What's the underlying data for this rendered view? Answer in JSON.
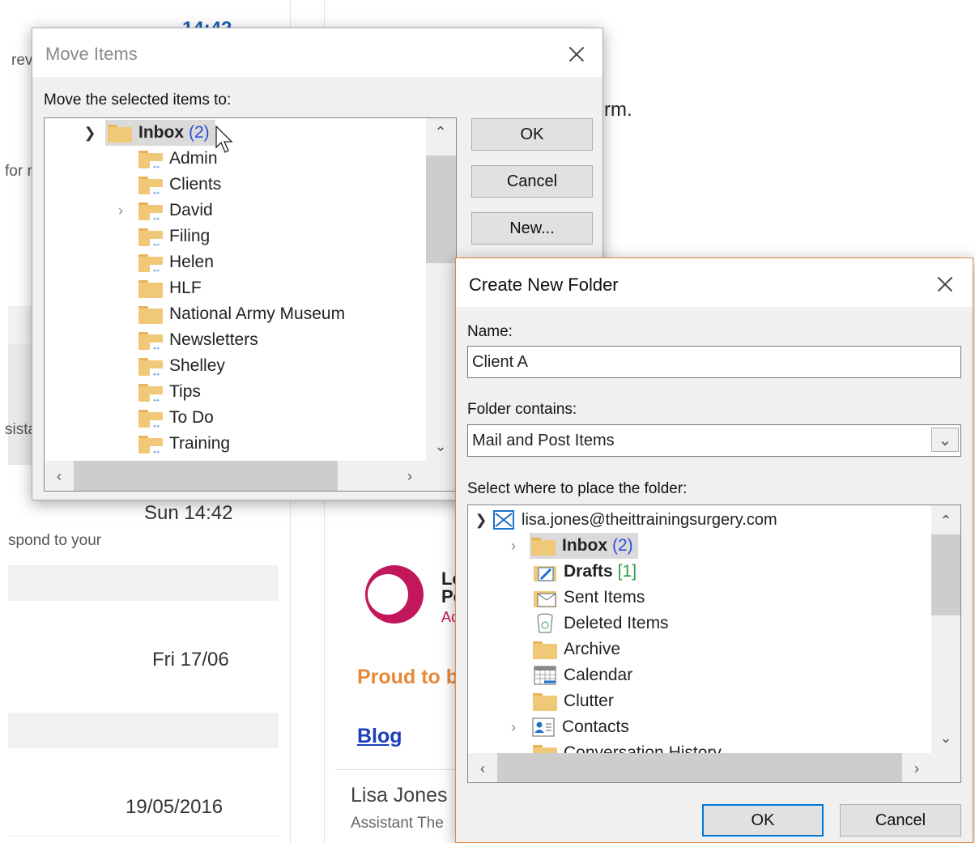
{
  "background": {
    "list_fragments": [
      "rev",
      "for r",
      "sista",
      "spond to your"
    ],
    "list_dates": [
      "14:42",
      "Sun 14:42",
      "Fri 17/06",
      "19/05/2016"
    ],
    "reading_fragments": [
      "rm.",
      "Le",
      "Pe",
      "Ac",
      "Proud to b",
      "Blog ",
      "Lisa Jones",
      "Assistant  The"
    ]
  },
  "move_dialog": {
    "title": "Move Items",
    "prompt": "Move the selected items to:",
    "folders": [
      {
        "label": "Inbox",
        "count": "(2)",
        "bold": true,
        "chevron": "v"
      },
      {
        "label": "Admin"
      },
      {
        "label": "Clients"
      },
      {
        "label": "David",
        "chevron": ">"
      },
      {
        "label": "Filing"
      },
      {
        "label": "Helen"
      },
      {
        "label": "HLF"
      },
      {
        "label": "National Army Museum"
      },
      {
        "label": "Newsletters"
      },
      {
        "label": "Shelley"
      },
      {
        "label": "Tips"
      },
      {
        "label": "To Do"
      },
      {
        "label": "Training"
      }
    ],
    "ok_label": "OK",
    "cancel_label": "Cancel",
    "new_label": "New..."
  },
  "create_dialog": {
    "title": "Create New Folder",
    "name_label": "Name:",
    "name_value": "Client A",
    "contains_label": "Folder contains:",
    "contains_value": "Mail and Post Items",
    "place_label": "Select where to place the folder:",
    "account": "lisa.jones@theittrainingsurgery.com",
    "folders": [
      {
        "label": "Inbox",
        "count": "(2)",
        "bold": true,
        "chevron": ">"
      },
      {
        "label": "Drafts",
        "count": "[1]",
        "bold": true
      },
      {
        "label": "Sent Items"
      },
      {
        "label": "Deleted Items"
      },
      {
        "label": "Archive"
      },
      {
        "label": "Calendar"
      },
      {
        "label": "Clutter"
      },
      {
        "label": "Contacts",
        "chevron": ">"
      },
      {
        "label": "Conversation History"
      }
    ],
    "ok_label": "OK",
    "cancel_label": "Cancel"
  },
  "colors": {
    "accent": "#0078d7",
    "dialog_border_active": "#e6883c",
    "count_blue": "#2a4fd6",
    "count_green": "#2e9e3e",
    "link": "#1a3fb8",
    "orange_text": "#e8893a",
    "brand_pink": "#c2185b"
  }
}
